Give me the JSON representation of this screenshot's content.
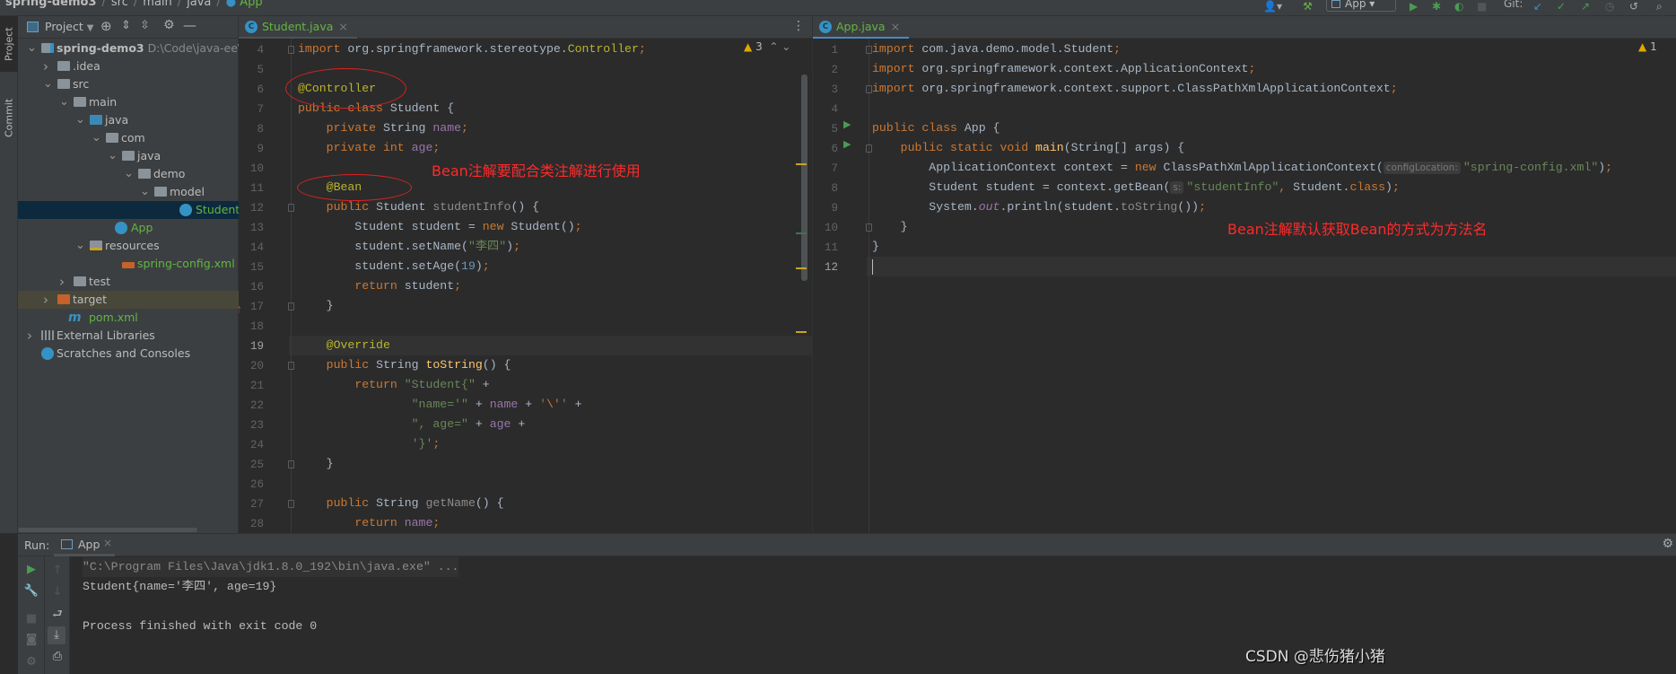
{
  "breadcrumb": [
    "spring-demo3",
    "src",
    "main",
    "java",
    "App"
  ],
  "toolbar": {
    "run_config": "App",
    "git_label": "Git:",
    "icons": [
      "user-icon",
      "build-hammer-icon",
      "run-icon",
      "debug-icon",
      "coverage-icon",
      "stop-icon",
      "git-update-icon",
      "git-commit-icon",
      "git-push-icon",
      "history-icon",
      "rollback-icon",
      "search-icon"
    ]
  },
  "left_strip": {
    "project_tab": "Project",
    "commit_tab": "Commit"
  },
  "project": {
    "header": "Project",
    "tree": [
      {
        "label": "spring-demo3",
        "extra": "D:\\Code\\java-ee\\sp",
        "level": 0,
        "expanded": true,
        "icon": "module-folder",
        "bold": true
      },
      {
        "label": ".idea",
        "level": 1,
        "expanded": false,
        "icon": "folder"
      },
      {
        "label": "src",
        "level": 1,
        "expanded": true,
        "icon": "folder"
      },
      {
        "label": "main",
        "level": 2,
        "expanded": true,
        "icon": "folder"
      },
      {
        "label": "java",
        "level": 3,
        "expanded": true,
        "icon": "source-folder"
      },
      {
        "label": "com",
        "level": 4,
        "expanded": true,
        "icon": "package"
      },
      {
        "label": "java",
        "level": 5,
        "expanded": true,
        "icon": "package"
      },
      {
        "label": "demo",
        "level": 6,
        "expanded": true,
        "icon": "package"
      },
      {
        "label": "model",
        "level": 7,
        "expanded": true,
        "icon": "package"
      },
      {
        "label": "Student",
        "level": 9,
        "icon": "class",
        "color": "green",
        "selected": true
      },
      {
        "label": "App",
        "level": 5,
        "icon": "class-run",
        "color": "green"
      },
      {
        "label": "resources",
        "level": 3,
        "expanded": true,
        "icon": "resources-folder"
      },
      {
        "label": "spring-config.xml",
        "level": 5,
        "icon": "xml",
        "color": "green"
      },
      {
        "label": "test",
        "level": 2,
        "expanded": false,
        "icon": "folder"
      },
      {
        "label": "target",
        "level": 1,
        "expanded": false,
        "icon": "excluded-folder",
        "highlight": true
      },
      {
        "label": "pom.xml",
        "level": 2,
        "icon": "maven",
        "color": "green"
      },
      {
        "label": "External Libraries",
        "level": 0,
        "expanded": false,
        "icon": "libraries"
      },
      {
        "label": "Scratches and Consoles",
        "level": 1,
        "icon": "scratches"
      }
    ]
  },
  "editor_left": {
    "tab": "Student.java",
    "warnings": "3",
    "first_line": 4,
    "current_line": 19,
    "lines": [
      [
        [
          "kw",
          "import"
        ],
        [
          "t",
          " org.springframework.stereotype."
        ],
        [
          "ann",
          "Controller"
        ],
        [
          "kw",
          ";"
        ]
      ],
      [],
      [
        [
          "ann",
          "@Controller"
        ]
      ],
      [
        [
          "kw",
          "public class "
        ],
        [
          "t",
          "Student {"
        ]
      ],
      [
        [
          "t",
          "    "
        ],
        [
          "kw",
          "private "
        ],
        [
          "t",
          "String "
        ],
        [
          "fld",
          "name"
        ],
        [
          "kw",
          ";"
        ]
      ],
      [
        [
          "t",
          "    "
        ],
        [
          "kw",
          "private int "
        ],
        [
          "fld",
          "age"
        ],
        [
          "kw",
          ";"
        ]
      ],
      [],
      [
        [
          "t",
          "    "
        ],
        [
          "ann",
          "@Bean"
        ]
      ],
      [
        [
          "t",
          "    "
        ],
        [
          "kw",
          "public "
        ],
        [
          "t",
          "Student "
        ],
        [
          "un",
          "studentInfo"
        ],
        [
          "t",
          "() {"
        ]
      ],
      [
        [
          "t",
          "        Student student = "
        ],
        [
          "kw",
          "new "
        ],
        [
          "t",
          "Student()"
        ],
        [
          "kw",
          ";"
        ]
      ],
      [
        [
          "t",
          "        student.setName("
        ],
        [
          "str",
          "\"李四\""
        ],
        [
          "t",
          ")"
        ],
        [
          "kw",
          ";"
        ]
      ],
      [
        [
          "t",
          "        student.setAge("
        ],
        [
          "num",
          "19"
        ],
        [
          "t",
          ")"
        ],
        [
          "kw",
          ";"
        ]
      ],
      [
        [
          "t",
          "        "
        ],
        [
          "kw",
          "return "
        ],
        [
          "t",
          "student"
        ],
        [
          "kw",
          ";"
        ]
      ],
      [
        [
          "t",
          "    }"
        ]
      ],
      [],
      [
        [
          "t",
          "    "
        ],
        [
          "ann",
          "@Override"
        ]
      ],
      [
        [
          "t",
          "    "
        ],
        [
          "kw",
          "public "
        ],
        [
          "t",
          "String "
        ],
        [
          "mth",
          "toString"
        ],
        [
          "t",
          "() {"
        ]
      ],
      [
        [
          "t",
          "        "
        ],
        [
          "kw",
          "return "
        ],
        [
          "str",
          "\"Student{\""
        ],
        [
          "t",
          " +"
        ]
      ],
      [
        [
          "t",
          "                "
        ],
        [
          "str",
          "\"name='\""
        ],
        [
          "t",
          " + "
        ],
        [
          "fld",
          "name"
        ],
        [
          "t",
          " + "
        ],
        [
          "str",
          "'"
        ],
        [
          "kw",
          "\\'"
        ],
        [
          "str",
          "'"
        ],
        [
          "t",
          " +"
        ]
      ],
      [
        [
          "t",
          "                "
        ],
        [
          "str",
          "\", age=\""
        ],
        [
          "t",
          " + "
        ],
        [
          "fld",
          "age"
        ],
        [
          "t",
          " +"
        ]
      ],
      [
        [
          "t",
          "                "
        ],
        [
          "str",
          "'}'"
        ],
        [
          "kw",
          ";"
        ]
      ],
      [
        [
          "t",
          "    }"
        ]
      ],
      [],
      [
        [
          "t",
          "    "
        ],
        [
          "kw",
          "public "
        ],
        [
          "t",
          "String "
        ],
        [
          "un",
          "getName"
        ],
        [
          "t",
          "() {"
        ]
      ],
      [
        [
          "t",
          "        "
        ],
        [
          "kw",
          "return "
        ],
        [
          "fld",
          "name"
        ],
        [
          "kw",
          ";"
        ]
      ]
    ],
    "annotation_note": "Bean注解要配合类注解进行使用"
  },
  "editor_right": {
    "tab": "App.java",
    "warnings": "1",
    "first_line": 1,
    "current_line": 12,
    "lines": [
      [
        [
          "kw",
          "import"
        ],
        [
          "t",
          " com.java.demo.model.Student"
        ],
        [
          "kw",
          ";"
        ]
      ],
      [
        [
          "kw",
          "import"
        ],
        [
          "t",
          " org.springframework.context.ApplicationContext"
        ],
        [
          "kw",
          ";"
        ]
      ],
      [
        [
          "kw",
          "import"
        ],
        [
          "t",
          " org.springframework.context.support.ClassPathXmlApplicationContext"
        ],
        [
          "kw",
          ";"
        ]
      ],
      [],
      [
        [
          "kw",
          "public class "
        ],
        [
          "t",
          "App {"
        ]
      ],
      [
        [
          "t",
          "    "
        ],
        [
          "kw",
          "public static void "
        ],
        [
          "mth",
          "main"
        ],
        [
          "t",
          "(String[] args) {"
        ]
      ],
      [
        [
          "t",
          "        ApplicationContext context = "
        ],
        [
          "kw",
          "new "
        ],
        [
          "t",
          "ClassPathXmlApplicationContext("
        ],
        [
          "hint",
          "configLocation:"
        ],
        [
          "str",
          "\"spring-config.xml\""
        ],
        [
          "t",
          ")"
        ],
        [
          "kw",
          ";"
        ]
      ],
      [
        [
          "t",
          "        Student student = context.getBean("
        ],
        [
          "hint",
          "s:"
        ],
        [
          "str",
          "\"studentInfo\""
        ],
        [
          "kw",
          ", "
        ],
        [
          "t",
          "Student."
        ],
        [
          "kw",
          "class"
        ],
        [
          "t",
          ")"
        ],
        [
          "kw",
          ";"
        ]
      ],
      [
        [
          "t",
          "        System."
        ],
        [
          "st",
          "out"
        ],
        [
          "t",
          ".println(student."
        ],
        [
          "un",
          "toString"
        ],
        [
          "t",
          "())"
        ],
        [
          "kw",
          ";"
        ]
      ],
      [
        [
          "t",
          "    }"
        ]
      ],
      [
        [
          "t",
          "}"
        ]
      ],
      []
    ],
    "annotation_note": "Bean注解默认获取Bean的方式为方法名"
  },
  "run_panel": {
    "label": "Run:",
    "tab": "App",
    "output": [
      "\"C:\\Program Files\\Java\\jdk1.8.0_192\\bin\\java.exe\" ...",
      "Student{name='李四', age=19}",
      "",
      "Process finished with exit code 0"
    ]
  },
  "watermark": "CSDN @悲伤猪小猪",
  "colors": {
    "background": "#2b2b2b",
    "panel": "#3c3f41",
    "keyword": "#cc7832",
    "string": "#6a8759",
    "annotation": "#bbb529",
    "field": "#9876aa",
    "selection": "#0d293e",
    "note_red": "#ff2a2a",
    "run_green": "#499c54"
  }
}
